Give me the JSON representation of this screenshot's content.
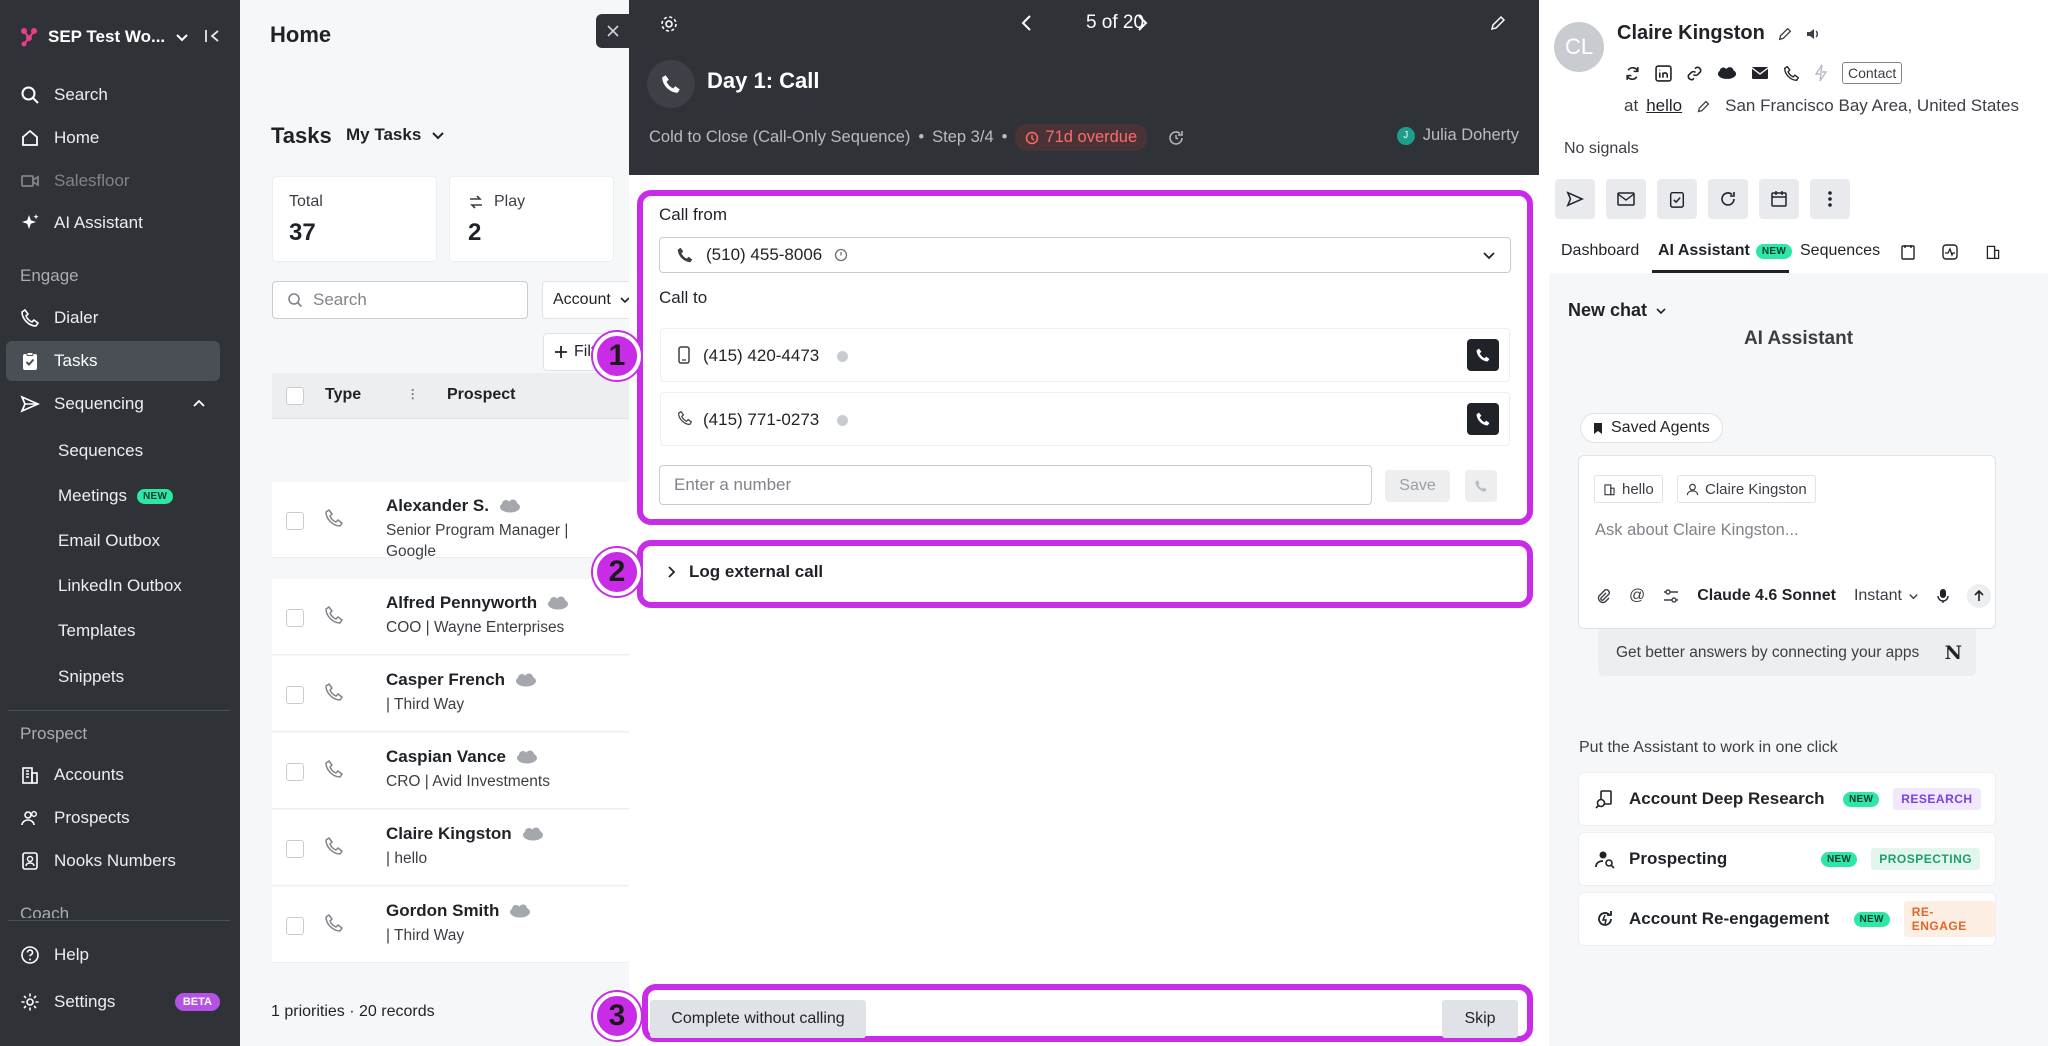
{
  "sidebar": {
    "workspace": "SEP Test Wo...",
    "search": "Search",
    "home": "Home",
    "salesfloor": "Salesfloor",
    "ai_assistant": "AI Assistant",
    "engage": "Engage",
    "dialer": "Dialer",
    "tasks": "Tasks",
    "sequencing": "Sequencing",
    "sequences": "Sequences",
    "meetings": "Meetings",
    "meetings_badge": "NEW",
    "email_outbox": "Email Outbox",
    "linkedin_outbox": "LinkedIn Outbox",
    "templates": "Templates",
    "snippets": "Snippets",
    "prospect": "Prospect",
    "accounts": "Accounts",
    "prospects": "Prospects",
    "nooks_numbers": "Nooks Numbers",
    "coach": "Coach",
    "help": "Help",
    "settings": "Settings",
    "settings_badge": "BETA"
  },
  "home": {
    "title": "Home",
    "tasks_label": "Tasks",
    "my_tasks": "My Tasks",
    "cards": [
      {
        "label": "Total",
        "value": "37"
      },
      {
        "label": "Play",
        "value": "2"
      }
    ],
    "search_placeholder": "Search",
    "account_filter": "Account",
    "filter_btn": "Filt",
    "col_type": "Type",
    "col_prospect": "Prospect",
    "rows": [
      {
        "name": "Alexander S.",
        "sub": "Senior Program Manager | Google"
      },
      {
        "name": "Alfred Pennyworth",
        "sub": "COO | Wayne Enterprises"
      },
      {
        "name": "Casper French",
        "sub": "| Third Way"
      },
      {
        "name": "Caspian Vance",
        "sub": "CRO | Avid Investments"
      },
      {
        "name": "Claire Kingston",
        "sub": "| hello"
      },
      {
        "name": "Gordon Smith",
        "sub": "| Third Way"
      }
    ],
    "footer": "1 priorities · 20 records"
  },
  "dialer": {
    "pager": "5 of 20",
    "task_title": "Day 1: Call",
    "sequence": "Cold to Close (Call-Only Sequence)",
    "step": "Step 3/4",
    "overdue": "71d overdue",
    "owner": "Julia Doherty",
    "owner_initial": "J",
    "call_from_label": "Call from",
    "call_from_value": "(510) 455-8006",
    "call_to_label": "Call to",
    "numbers": [
      "(415) 420-4473",
      "(415) 771-0273"
    ],
    "enter_placeholder": "Enter a number",
    "save": "Save",
    "log_external": "Log external call",
    "complete": "Complete without calling",
    "skip": "Skip",
    "markers": [
      "1",
      "2",
      "3"
    ]
  },
  "contact": {
    "initials": "CL",
    "name": "Claire Kingston",
    "contact_tag": "Contact",
    "at": "at",
    "company": "hello",
    "location": "San Francisco Bay Area, United States",
    "signals": "No signals",
    "tabs": [
      "Dashboard",
      "AI Assistant",
      "Sequences"
    ],
    "ai_badge": "NEW",
    "new_chat": "New chat",
    "assistant_heading": "AI Assistant",
    "saved_agents": "Saved Agents",
    "chip_company": "hello",
    "chip_person": "Claire Kingston",
    "ask_placeholder": "Ask about Claire Kingston...",
    "model": "Claude 4.6 Sonnet",
    "mode": "Instant",
    "connect_apps": "Get better answers by connecting your apps",
    "put_to_work": "Put the Assistant to work in one click",
    "agents": [
      {
        "name": "Account Deep Research",
        "badge": "NEW",
        "tag": "RESEARCH",
        "tag_color": "#7b3fe4",
        "tag_bg": "#f0e8fd"
      },
      {
        "name": "Prospecting",
        "badge": "NEW",
        "tag": "PROSPECTING",
        "tag_color": "#1f9d6b",
        "tag_bg": "#e3f6ee"
      },
      {
        "name": "Account Re-engagement",
        "badge": "NEW",
        "tag": "RE-ENGAGE",
        "tag_color": "#e0672a",
        "tag_bg": "#fdeee4"
      }
    ]
  },
  "colors": {
    "accent": "#c82ce6",
    "sidebar": "#2f3237",
    "overdue": "#ff6b6b"
  }
}
